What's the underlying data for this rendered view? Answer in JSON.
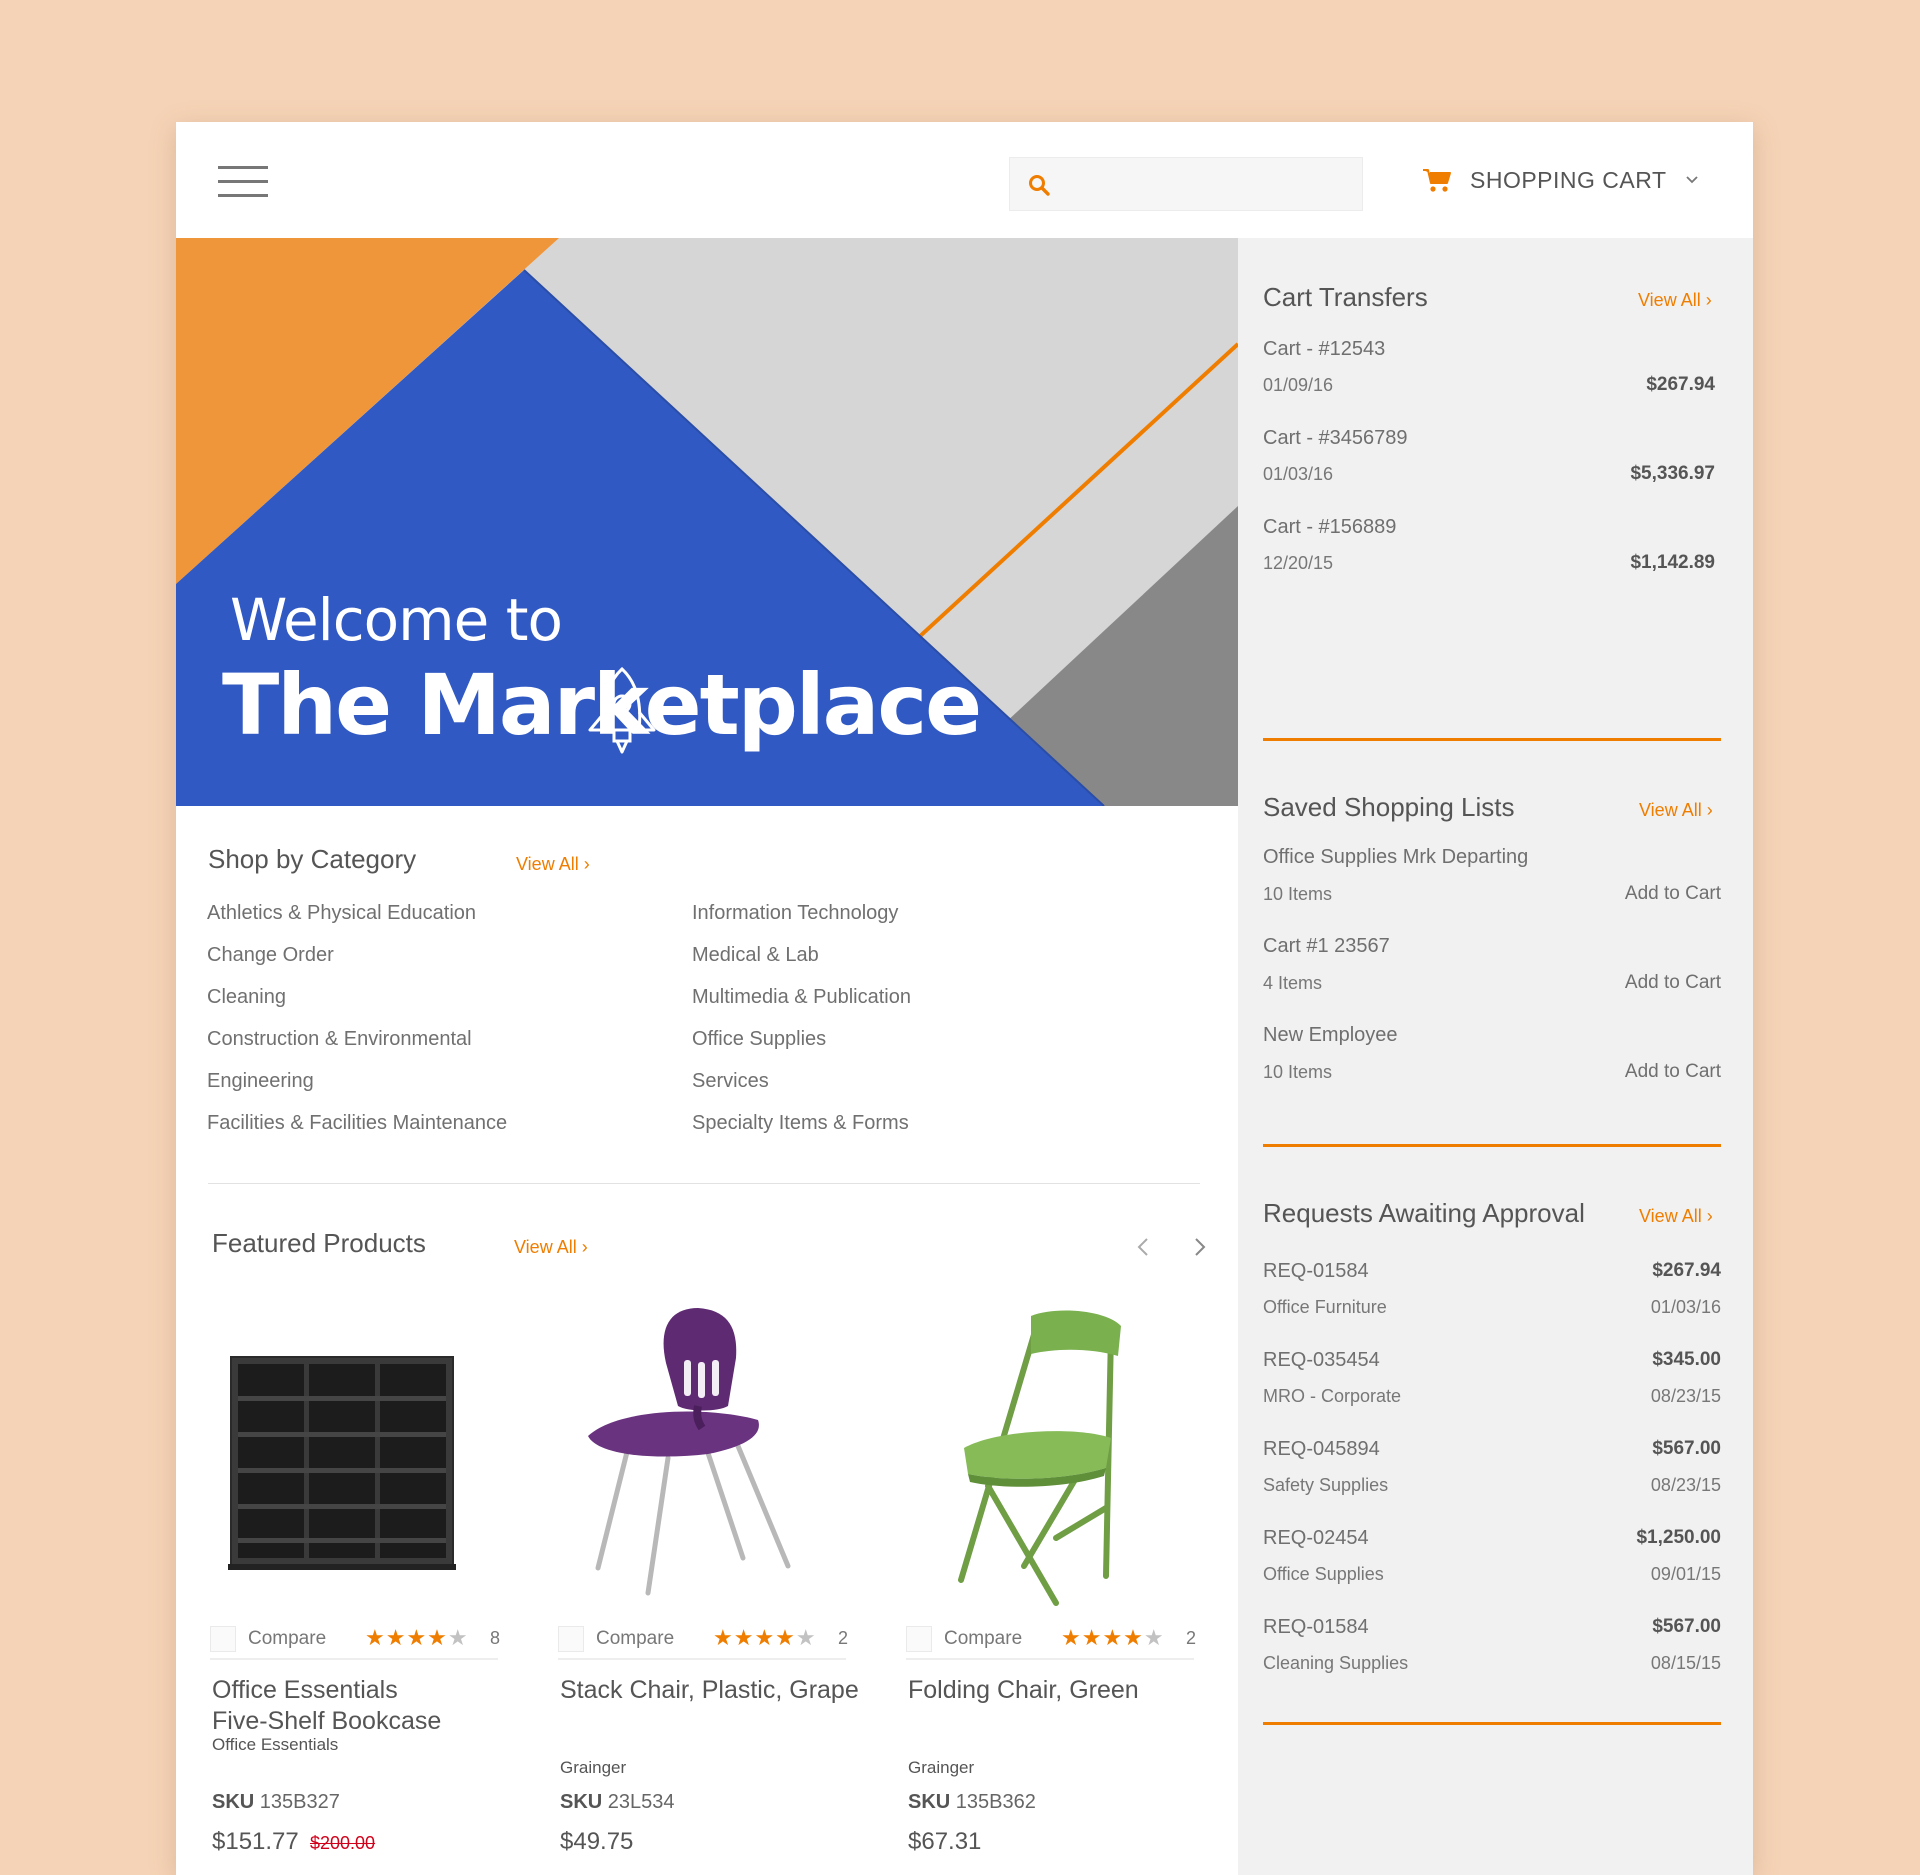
{
  "header": {
    "search_placeholder": "",
    "cart_label": "SHOPPING CART"
  },
  "hero": {
    "welcome": "Welcome to",
    "title": "The Marketplace",
    "colors": {
      "orange": "#f0963a",
      "blue": "#3059c4",
      "light_gray": "#d6d6d6",
      "dark_gray": "#888888"
    }
  },
  "category": {
    "title": "Shop by Category",
    "view_all": "View All ›",
    "left": [
      "Athletics & Physical Education",
      "Change Order",
      "Cleaning",
      "Construction & Environmental",
      "Engineering",
      "Facilities & Facilities Maintenance"
    ],
    "right": [
      "Information Technology",
      "Medical & Lab",
      "Multimedia & Publication",
      "Office Supplies",
      "Services",
      "Specialty Items & Forms"
    ]
  },
  "featured": {
    "title": "Featured Products",
    "view_all": "View All ›",
    "compare_label": "Compare",
    "sku_label": "SKU",
    "products": [
      {
        "name_line1": "Office Essentials",
        "name_line2": "Five-Shelf Bookcase",
        "brand": "Office Essentials",
        "sku": "135B327",
        "price": "$151.77",
        "old_price": "$200.00",
        "rating": 4,
        "reviews": "8"
      },
      {
        "name_line1": "Stack Chair, Plastic, Grape",
        "name_line2": "",
        "brand": "Grainger",
        "sku": "23L534",
        "price": "$49.75",
        "old_price": "",
        "rating": 4,
        "reviews": "2"
      },
      {
        "name_line1": "Folding Chair, Green",
        "name_line2": "",
        "brand": "Grainger",
        "sku": "135B362",
        "price": "$67.31",
        "old_price": "",
        "rating": 4,
        "reviews": "2"
      }
    ]
  },
  "cart_transfers": {
    "title": "Cart Transfers",
    "view_all": "View All ›",
    "items": [
      {
        "name": "Cart - #12543",
        "date": "01/09/16",
        "amount": "$267.94"
      },
      {
        "name": "Cart - #3456789",
        "date": "01/03/16",
        "amount": "$5,336.97"
      },
      {
        "name": "Cart - #156889",
        "date": "12/20/15",
        "amount": "$1,142.89"
      }
    ]
  },
  "saved_lists": {
    "title": "Saved Shopping Lists",
    "view_all": "View All ›",
    "action": "Add to Cart",
    "items": [
      {
        "name": "Office Supplies Mrk Departing",
        "count": "10 Items"
      },
      {
        "name": "Cart #1 23567",
        "count": "4 Items"
      },
      {
        "name": "New Employee",
        "count": "10 Items"
      }
    ]
  },
  "approvals": {
    "title": "Requests Awaiting Approval",
    "view_all": "View All ›",
    "items": [
      {
        "id": "REQ-01584",
        "category": "Office Furniture",
        "amount": "$267.94",
        "date": "01/03/16"
      },
      {
        "id": "REQ-035454",
        "category": "MRO - Corporate",
        "amount": "$345.00",
        "date": "08/23/15"
      },
      {
        "id": "REQ-045894",
        "category": "Safety Supplies",
        "amount": "$567.00",
        "date": "08/23/15"
      },
      {
        "id": "REQ-02454",
        "category": "Office Supplies",
        "amount": "$1,250.00",
        "date": "09/01/15"
      },
      {
        "id": "REQ-01584",
        "category": "Cleaning Supplies",
        "amount": "$567.00",
        "date": "08/15/15"
      }
    ]
  },
  "accent_color": "#ef7d00"
}
